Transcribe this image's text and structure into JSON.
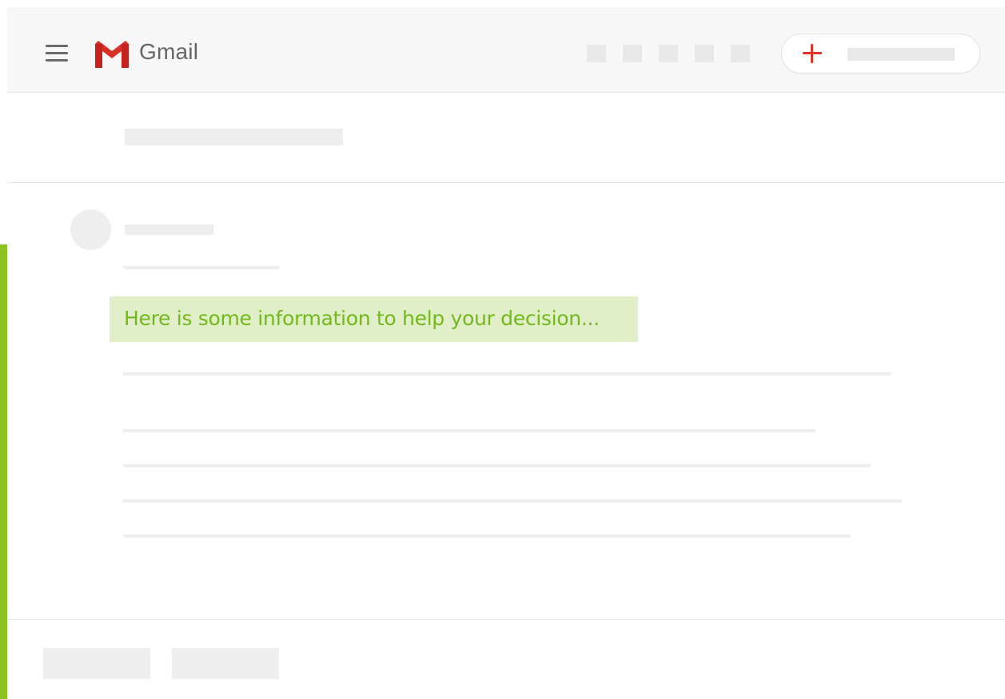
{
  "app": {
    "name": "Gmail"
  },
  "colors": {
    "accent_green": "#8cc31e",
    "highlight_background": "#e0efc7",
    "highlight_text": "#73b81c",
    "compose_plus": "#e0342b",
    "gmail_red": "#d93025"
  },
  "header": {
    "menu_icon": "hamburger-menu-icon",
    "logo_icon": "gmail-m-logo-icon",
    "logo_text": "Gmail",
    "toolbar_icons": [
      "toolbar-icon",
      "toolbar-icon",
      "toolbar-icon",
      "toolbar-icon",
      "toolbar-icon"
    ],
    "compose_icon": "plus-icon"
  },
  "message": {
    "highlight_text": "Here is some information to help your decision..."
  }
}
